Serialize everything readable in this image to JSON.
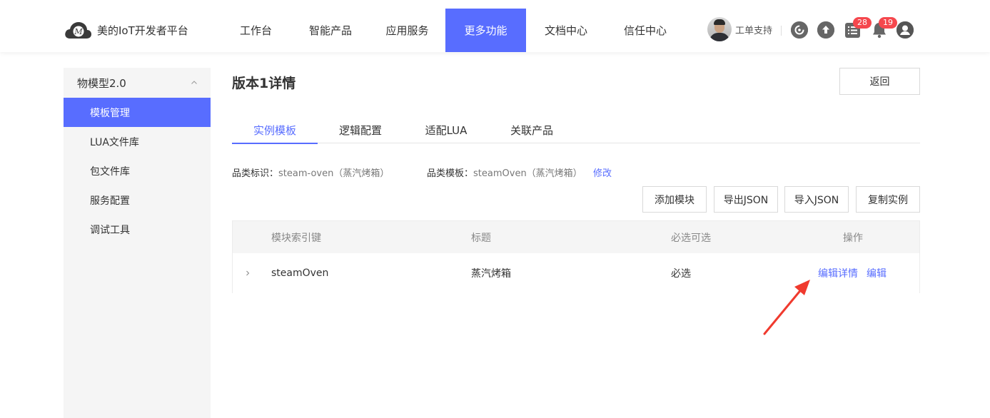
{
  "brand": {
    "title": "美的IoT开发者平台"
  },
  "nav": {
    "items": [
      {
        "label": "工作台"
      },
      {
        "label": "智能产品"
      },
      {
        "label": "应用服务"
      },
      {
        "label": "更多功能",
        "active": true
      },
      {
        "label": "文档中心"
      },
      {
        "label": "信任中心"
      }
    ]
  },
  "user": {
    "name": "工单支持"
  },
  "header_icons": {
    "items": [
      {
        "icon": "refresh-icon"
      },
      {
        "icon": "upload-icon"
      },
      {
        "icon": "task-list-icon",
        "badge": "28"
      },
      {
        "icon": "bell-icon",
        "badge": "19"
      },
      {
        "icon": "user-icon"
      }
    ]
  },
  "sidebar": {
    "group": "物模型2.0",
    "items": [
      {
        "label": "模板管理",
        "active": true
      },
      {
        "label": "LUA文件库"
      },
      {
        "label": "包文件库"
      },
      {
        "label": "服务配置"
      },
      {
        "label": "调试工具"
      }
    ]
  },
  "main": {
    "title": "版本1详情",
    "back_label": "返回",
    "tabs": [
      {
        "label": "实例模板",
        "active": true
      },
      {
        "label": "逻辑配置"
      },
      {
        "label": "适配LUA"
      },
      {
        "label": "关联产品"
      }
    ],
    "meta": {
      "category_id_label": "品类标识：",
      "category_id_value": "steam-oven（蒸汽烤箱）",
      "category_template_label": "品类模板：",
      "category_template_value": "steamOven（蒸汽烤箱）",
      "modify_label": "修改"
    },
    "actions": {
      "add_module": "添加模块",
      "export_json": "导出JSON",
      "import_json": "导入JSON",
      "copy_instance": "复制实例"
    },
    "table": {
      "columns": [
        "模块索引键",
        "标题",
        "必选可选",
        "操作"
      ],
      "rows": [
        {
          "key": "steamOven",
          "title": "蒸汽烤箱",
          "required": "必选",
          "actions": [
            "编辑详情",
            "编辑"
          ]
        }
      ]
    }
  },
  "colors": {
    "accent": "#586dff",
    "badge": "#f5474d",
    "annotation_arrow": "#f03a2e",
    "sidebar_bg": "#f5f5f5"
  }
}
